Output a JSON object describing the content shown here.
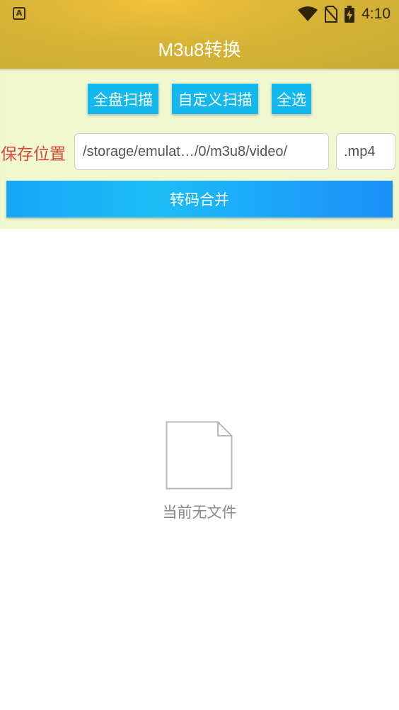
{
  "status_bar": {
    "notification_icon_letter": "A",
    "time": "4:10",
    "icons": [
      "wifi-icon",
      "no-sim-icon",
      "battery-charging-icon"
    ]
  },
  "app_bar": {
    "title": "M3u8转换"
  },
  "toolbar": {
    "scan_all_label": "全盘扫描",
    "custom_scan_label": "自定义扫描",
    "select_all_label": "全选"
  },
  "save": {
    "label": "保存位置",
    "path_value": "/storage/emulat…/0/m3u8/video/",
    "extension_value": ".mp4"
  },
  "convert": {
    "label": "转码合并"
  },
  "empty_state": {
    "icon": "file-icon",
    "text": "当前无文件"
  },
  "colors": {
    "app_bar": "#d8b435",
    "panel_background": "#f1f8d0",
    "button_blue": "#12b8ee",
    "save_label_red": "#d9483b"
  }
}
